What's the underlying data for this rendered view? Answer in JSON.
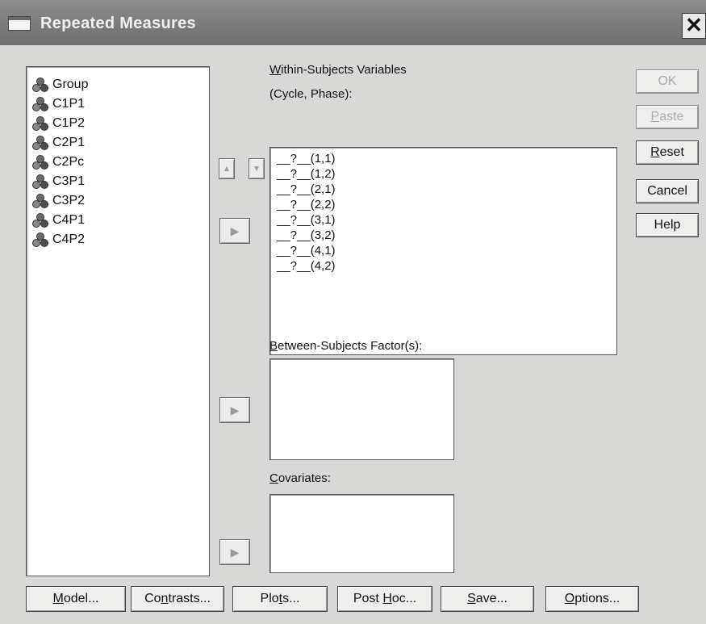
{
  "window": {
    "title": "Repeated Measures",
    "close_glyph": "✕"
  },
  "source_variables": [
    "Group",
    "C1P1",
    "C1P2",
    "C2P1",
    "C2Pc",
    "C3P1",
    "C3P2",
    "C4P1",
    "C4P2"
  ],
  "within": {
    "label_accel": "W",
    "label_rest": "ithin-Subjects Variables",
    "sublabel": "(Cycle, Phase):",
    "items": [
      "__?__(1,1)",
      "__?__(1,2)",
      "__?__(2,1)",
      "__?__(2,2)",
      "__?__(3,1)",
      "__?__(3,2)",
      "__?__(4,1)",
      "__?__(4,2)"
    ]
  },
  "between": {
    "label_accel": "B",
    "label_rest": "etween-Subjects Factor(s):"
  },
  "covariates": {
    "label_accel": "C",
    "label_rest": "ovariates:"
  },
  "side_buttons": {
    "ok": "OK",
    "paste_accel": "P",
    "paste_rest": "aste",
    "reset_accel": "R",
    "reset_rest": "eset",
    "cancel": "Cancel",
    "help": "Help"
  },
  "bottom_buttons": {
    "model_accel": "M",
    "model_rest": "odel...",
    "contrasts_pre": "Co",
    "contrasts_accel": "n",
    "contrasts_rest": "trasts...",
    "plots_pre": "Plo",
    "plots_accel": "t",
    "plots_rest": "s...",
    "posthoc_pre": "Post ",
    "posthoc_accel": "H",
    "posthoc_rest": "oc...",
    "save_accel": "S",
    "save_rest": "ave...",
    "options_accel": "O",
    "options_rest": "ptions..."
  },
  "icons": {
    "variable": "nominal-variable-icon",
    "arrow_right": "right-arrow-icon",
    "arrow_up": "up-arrow-icon",
    "arrow_down": "down-arrow-icon"
  }
}
